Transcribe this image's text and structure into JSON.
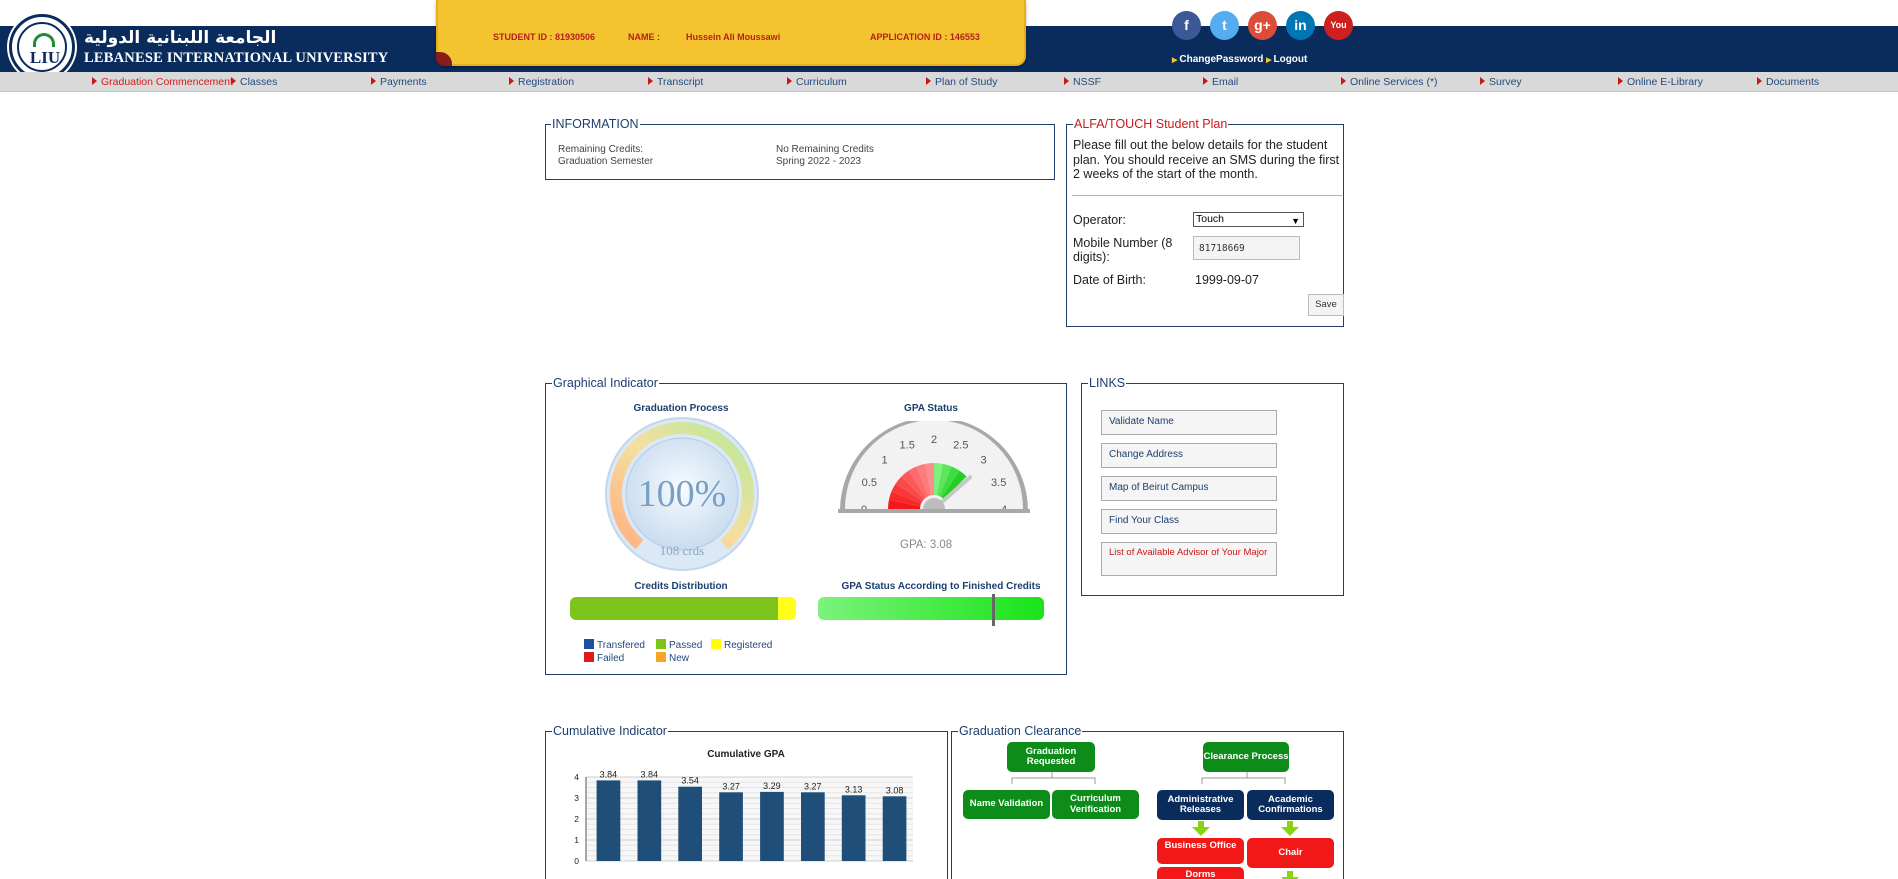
{
  "header": {
    "university_ar": "الجامعة اللبنانية الدولية",
    "university_en": "LEBANESE INTERNATIONAL UNIVERSITY",
    "logo_text": "LIU",
    "student_id_label": "STUDENT ID : 81930506",
    "name_label": "NAME :",
    "name_value": "Hussein Ali Moussawi",
    "application_id_label": "APPLICATION ID : 146553",
    "change_password": "ChangePassword",
    "logout": "Logout",
    "social": [
      {
        "name": "facebook-icon",
        "glyph": "f",
        "color": "#3b5998"
      },
      {
        "name": "twitter-icon",
        "glyph": "t",
        "color": "#55acee"
      },
      {
        "name": "google-plus-icon",
        "glyph": "g+",
        "color": "#dd4b39"
      },
      {
        "name": "linkedin-icon",
        "glyph": "in",
        "color": "#0077b5"
      },
      {
        "name": "youtube-icon",
        "glyph": "You",
        "color": "#cd201f"
      }
    ]
  },
  "nav": [
    {
      "id": "graduation-commencement",
      "label": "Graduation Commencement",
      "active": true
    },
    {
      "id": "classes",
      "label": "Classes"
    },
    {
      "id": "payments",
      "label": "Payments"
    },
    {
      "id": "registration",
      "label": "Registration"
    },
    {
      "id": "transcript",
      "label": "Transcript"
    },
    {
      "id": "curriculum",
      "label": "Curriculum"
    },
    {
      "id": "plan-of-study",
      "label": "Plan of Study"
    },
    {
      "id": "nssf",
      "label": "NSSF"
    },
    {
      "id": "email",
      "label": "Email"
    },
    {
      "id": "online-services",
      "label": "Online Services (*)"
    },
    {
      "id": "survey",
      "label": "Survey"
    },
    {
      "id": "online-e-library",
      "label": "Online E-Library"
    },
    {
      "id": "documents",
      "label": "Documents"
    }
  ],
  "information": {
    "legend": "INFORMATION",
    "remaining_credits_label": "Remaining Credits:",
    "remaining_credits_value": "No Remaining Credits",
    "graduation_semester_label": "Graduation Semester",
    "graduation_semester_value": "Spring 2022 - 2023"
  },
  "student_plan": {
    "legend": "ALFA/TOUCH Student Plan",
    "description": "Please fill out the below details for the student plan. You should receive an SMS during the first 2 weeks of the start of the month.",
    "operator_label": "Operator:",
    "operator_value": "Touch",
    "mobile_label": "Mobile Number (8 digits):",
    "mobile_value": "81718669",
    "dob_label": "Date of Birth:",
    "dob_value": "1999-09-07",
    "save_label": "Save"
  },
  "graphical": {
    "legend": "Graphical Indicator",
    "graduation_process_title": "Graduation Process",
    "graduation_percent": "100%",
    "graduation_percent_value": 100,
    "graduation_credits": "108 crds",
    "gpa_status_title": "GPA Status",
    "gpa_ticks": [
      "0",
      "0.5",
      "1",
      "1.5",
      "2",
      "2.5",
      "3",
      "3.5",
      "4"
    ],
    "gpa_value": 3.08,
    "gpa_text": "GPA: 3.08",
    "credits_distribution_title": "Credits Distribution",
    "credits_passed_fraction": 0.92,
    "credits_registered_fraction": 0.08,
    "gpa_finished_title": "GPA Status According to Finished Credits",
    "gpa_finished_marker": 0.77,
    "legend_items": [
      {
        "label": "Transfered",
        "color": "#1c4fa0"
      },
      {
        "label": "Passed",
        "color": "#7dc41c"
      },
      {
        "label": "Registered",
        "color": "#ffff00"
      },
      {
        "label": "Failed",
        "color": "#e31919"
      },
      {
        "label": "New",
        "color": "#f5a623"
      }
    ]
  },
  "links": {
    "legend": "LINKS",
    "items": [
      {
        "label": "Validate Name",
        "red": false
      },
      {
        "label": "Change Address",
        "red": false
      },
      {
        "label": "Map of Beirut Campus",
        "red": false
      },
      {
        "label": "Find Your Class",
        "red": false
      },
      {
        "label": "List of Available Advisor of Your Major",
        "red": true
      }
    ]
  },
  "cumulative": {
    "legend": "Cumulative Indicator"
  },
  "chart_data": {
    "type": "bar",
    "title": "Cumulative GPA",
    "values": [
      3.84,
      3.84,
      3.54,
      3.27,
      3.29,
      3.27,
      3.13,
      3.08
    ],
    "labels": [
      "3.84",
      "3.84",
      "3.54",
      "3.27",
      "3.29",
      "3.27",
      "3.13",
      "3.08"
    ],
    "yticks": [
      "0",
      "1",
      "2",
      "3",
      "4"
    ],
    "ylim": [
      0,
      4
    ],
    "color": "#1f4e79"
  },
  "clearance": {
    "legend": "Graduation Clearance",
    "graduation_requested": "Graduation Requested",
    "name_validation": "Name Validation",
    "curriculum_verification": "Curriculum Verification",
    "clearance_process": "Clearance Process",
    "administrative_releases": "Administrative Releases",
    "academic_confirmations": "Academic Confirmations",
    "business_office": "Business Office",
    "chair": "Chair",
    "dorms": "Dorms"
  }
}
